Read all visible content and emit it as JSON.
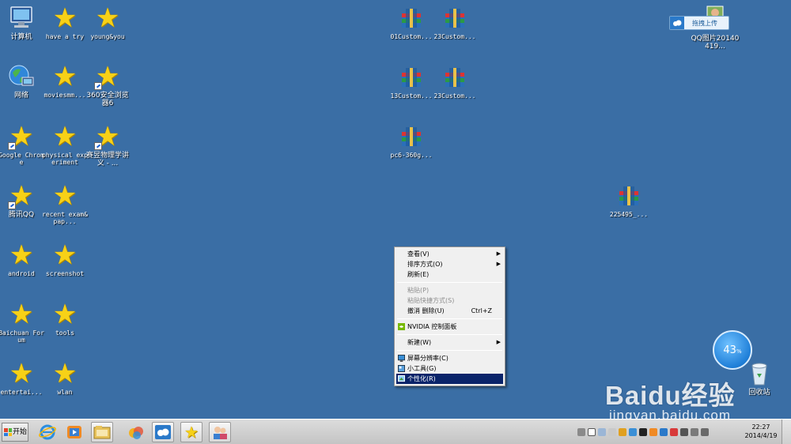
{
  "desktop": {
    "icons": {
      "computer": "计算机",
      "network": "网络",
      "have_a_try": "have a try",
      "youngyou": "young&you",
      "moviesmm": "moviesmm...",
      "browser360": "360安全浏览器6",
      "google_chrome": "Google Chrome",
      "physical_experiment": "physical experiment",
      "physics_notes": "赛昱物理学讲义 - ...",
      "tencent_qq": "腾讯QQ",
      "recent_exam": "recent exam&pap...",
      "android": "android",
      "screenshot": "screenshot",
      "baichuan_forum": "Baichuan Forum",
      "tools": "tools",
      "entertai": "entertai...",
      "wlan": "wlan",
      "rar_01custom": "01Custom...",
      "rar_23custom_a": "23Custom...",
      "rar_13custom": "13Custom...",
      "rar_23custom_b": "23Custom...",
      "rar_pc6": "pc6-360g...",
      "rar_225495": "225495_...",
      "qq_image": "QQ图片20140419...",
      "recycle_bin": "回收站"
    },
    "upload_button": "拖拽上传",
    "network_widget": {
      "value": "43",
      "unit": "%"
    },
    "watermark": {
      "main": "Baidu经验",
      "sub": "jingyan.baidu.com"
    }
  },
  "context_menu": {
    "items": [
      {
        "label": "查看(V)"
      },
      {
        "label": "排序方式(O)"
      },
      {
        "label": "刷新(E)"
      },
      {
        "label": "粘贴(P)"
      },
      {
        "label": "粘贴快捷方式(S)"
      },
      {
        "label": "撤消 删除(U)",
        "shortcut": "Ctrl+Z"
      },
      {
        "label": "NVIDIA 控制面板"
      },
      {
        "label": "新建(W)"
      },
      {
        "label": "屏幕分辨率(C)"
      },
      {
        "label": "小工具(G)"
      },
      {
        "label": "个性化(R)"
      }
    ]
  },
  "taskbar": {
    "start_label": "开始",
    "clock": {
      "time": "22:27",
      "date": "2014/4/19"
    }
  },
  "colors": {
    "desktop_bg": "#3a6ea5",
    "menu_highlight": "#0a246a",
    "star_yellow": "#f7d117"
  }
}
